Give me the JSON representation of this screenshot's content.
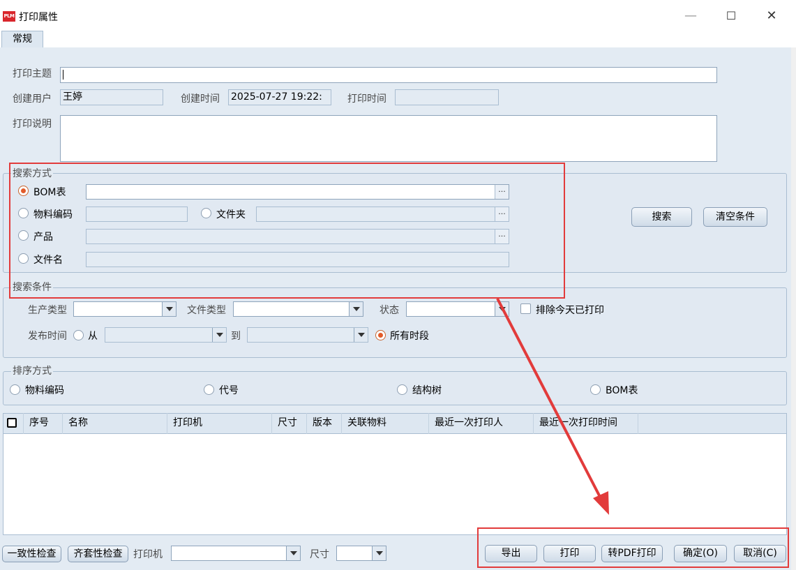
{
  "window": {
    "title": "打印属性",
    "logo_text": "PLM",
    "minimize": "—",
    "maximize": "☐",
    "close": "✕"
  },
  "tabs": [
    {
      "label": "常规"
    }
  ],
  "form": {
    "subject_label": "打印主题",
    "subject_value": "",
    "creator_label": "创建用户",
    "creator_value": "王婷",
    "create_time_label": "创建时间",
    "create_time_value": "2025-07-27 19:22:",
    "print_time_label": "打印时间",
    "print_time_value": "",
    "desc_label": "打印说明",
    "desc_value": ""
  },
  "search_mode": {
    "legend": "搜索方式",
    "bom_label": "BOM表",
    "bom_value": "",
    "material_label": "物料编码",
    "material_value": "",
    "folder_label": "文件夹",
    "folder_value": "",
    "product_label": "产品",
    "product_value": "",
    "filename_label": "文件名",
    "filename_value": "",
    "ellipsis": "...",
    "selected": "BOM表",
    "search_button": "搜索",
    "clear_button": "清空条件"
  },
  "search_cond": {
    "legend": "搜索条件",
    "prod_type_label": "生产类型",
    "prod_type_value": "",
    "file_type_label": "文件类型",
    "file_type_value": "",
    "status_label": "状态",
    "status_value": "",
    "exclude_label": "排除今天已打印",
    "exclude_checked": false,
    "pub_time_label": "发布时间",
    "from_label": "从",
    "from_value": "",
    "to_label": "到",
    "to_value": "",
    "all_period_label": "所有时段",
    "all_period_selected": true
  },
  "sort": {
    "legend": "排序方式",
    "options": [
      "物料编码",
      "代号",
      "结构树",
      "BOM表"
    ]
  },
  "table": {
    "columns": [
      "序号",
      "名称",
      "打印机",
      "尺寸",
      "版本",
      "关联物料",
      "最近一次打印人",
      "最近一次打印时间"
    ],
    "rows": []
  },
  "footer": {
    "consistency_button": "一致性检查",
    "completeness_button": "齐套性检查",
    "printer_label": "打印机",
    "printer_value": "",
    "size_label": "尺寸",
    "size_value": "",
    "export_button": "导出",
    "print_button": "打印",
    "pdf_button": "转PDF打印",
    "ok_button": "确定(O)",
    "cancel_button": "取消(C)"
  },
  "colors": {
    "accent": "#e23b3b",
    "panel": "#e3ebf3",
    "radio_on": "#e25b2a"
  }
}
